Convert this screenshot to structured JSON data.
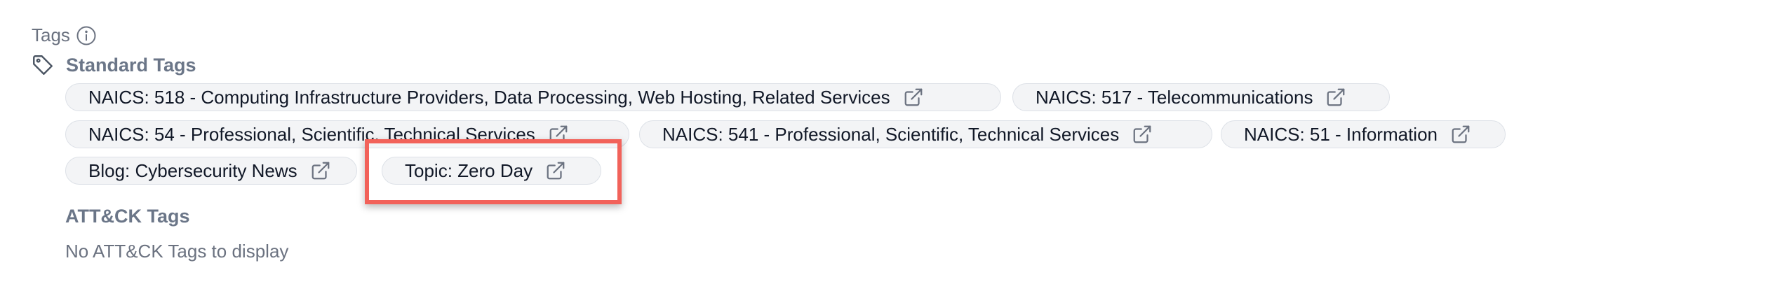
{
  "tags": {
    "title": "Tags",
    "info_icon": "info-icon"
  },
  "standard_tags": {
    "title": "Standard Tags",
    "icon": "tag-icon",
    "chips": [
      {
        "label": "NAICS: 518 - Computing Infrastructure Providers, Data Processing, Web Hosting, Related Services",
        "icon": "external-link-icon"
      },
      {
        "label": "NAICS: 517 - Telecommunications",
        "icon": "external-link-icon"
      },
      {
        "label": "NAICS: 54 - Professional, Scientific, Technical Services",
        "icon": "external-link-icon"
      },
      {
        "label": "NAICS: 541 - Professional, Scientific, Technical Services",
        "icon": "external-link-icon"
      },
      {
        "label": "NAICS: 51 - Information",
        "icon": "external-link-icon"
      },
      {
        "label": "Blog: Cybersecurity News",
        "icon": "external-link-icon"
      },
      {
        "label": "Topic: Zero Day",
        "icon": "external-link-icon",
        "highlighted": true
      }
    ]
  },
  "attck_tags": {
    "title": "ATT&CK Tags",
    "empty_message": "No ATT&CK Tags to display"
  },
  "colors": {
    "highlight": "#f2625a",
    "chip_background": "#f3f4f6",
    "chip_border": "#dde1e7",
    "section_title": "#6b7688"
  }
}
